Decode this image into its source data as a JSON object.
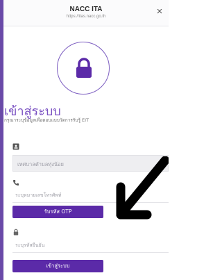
{
  "header": {
    "title": "NACC ITA",
    "url": "https://itas.nacc.go.th",
    "close_label": "×"
  },
  "lock": {
    "icon": "lock-icon",
    "accent": "#5b2aa8"
  },
  "login": {
    "title": "เข้าสู่ระบบ",
    "subtitle": "กรุณาระบุข้อมูลเพื่อตอบแบบวัดการรับรู้ EIT"
  },
  "fields": {
    "organization": {
      "icon": "id-card-icon",
      "value": "เทศบาลตำบลทุ่งน้อย"
    },
    "phone": {
      "icon": "phone-icon",
      "placeholder": "ระบุหมายเลขโทรศัพท์"
    },
    "otp_button": "รับรหัส OTP",
    "otp": {
      "icon": "lock-small-icon",
      "placeholder": "ระบุรหัสยืนยัน"
    },
    "login_button": "เข้าสู่ระบบ"
  },
  "colors": {
    "brand": "#5b2aa8",
    "accent_text": "#7a51c2",
    "strip": "#6a4aa8"
  }
}
